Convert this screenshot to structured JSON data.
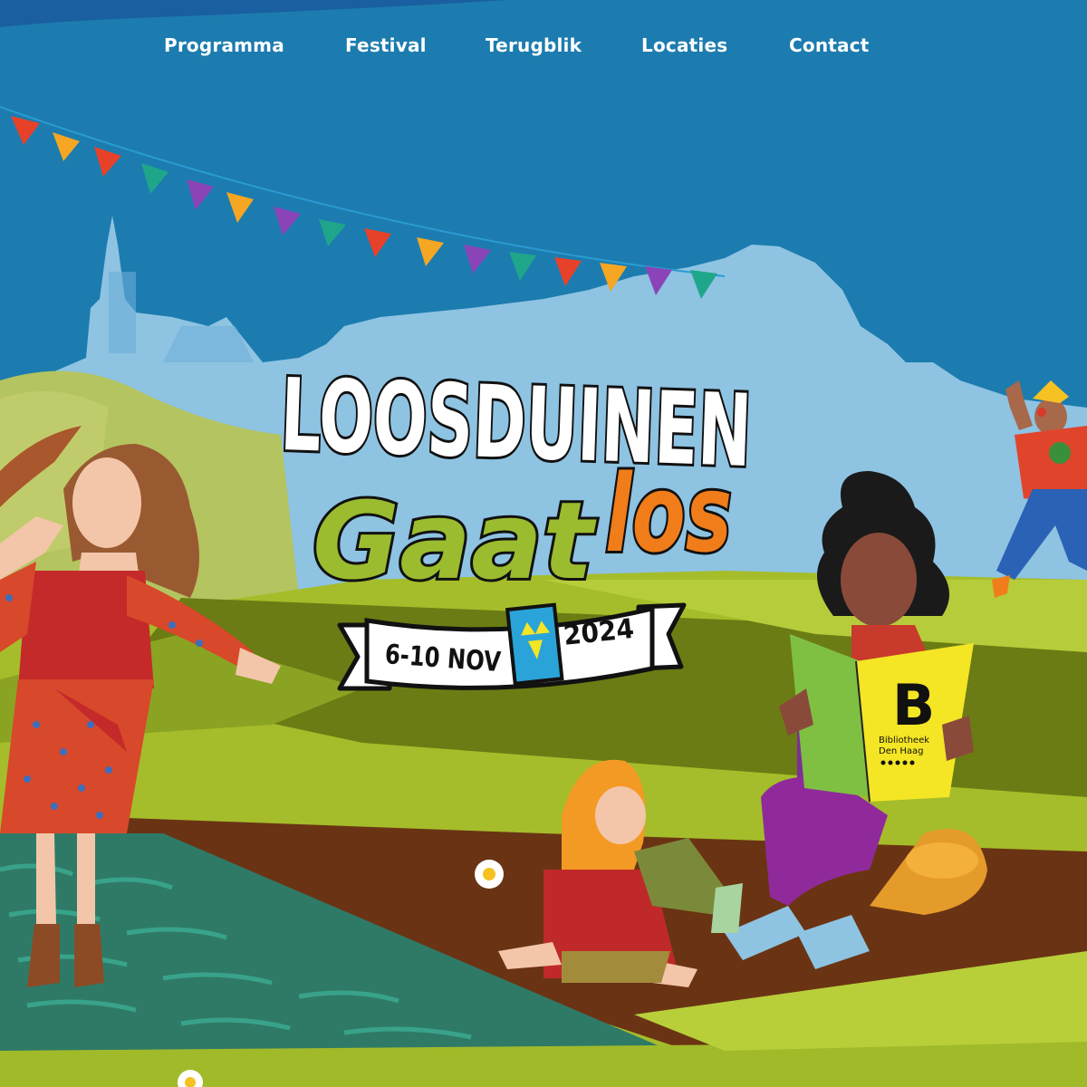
{
  "nav": {
    "items": [
      {
        "label": "Programma"
      },
      {
        "label": "Festival"
      },
      {
        "label": "Terugblik"
      },
      {
        "label": "Locaties"
      },
      {
        "label": "Contact"
      }
    ]
  },
  "logo": {
    "title_line1": "LOOSDUINEN",
    "title_line2_a": "Gaat",
    "title_line2_b": "los",
    "dates": "6-10 NOV",
    "year": "2024"
  },
  "book": {
    "letter": "B",
    "line1": "Bibliotheek",
    "line2": "Den Haag"
  },
  "colors": {
    "sky": "#1c7caf",
    "skyline": "#8ec3e2",
    "field_light": "#a5bd2a",
    "field_dark": "#6b7c14",
    "path": "#6a3414",
    "accent_orange": "#f07d1a",
    "accent_green": "#9bbc2e",
    "book_yellow": "#f4e525"
  }
}
